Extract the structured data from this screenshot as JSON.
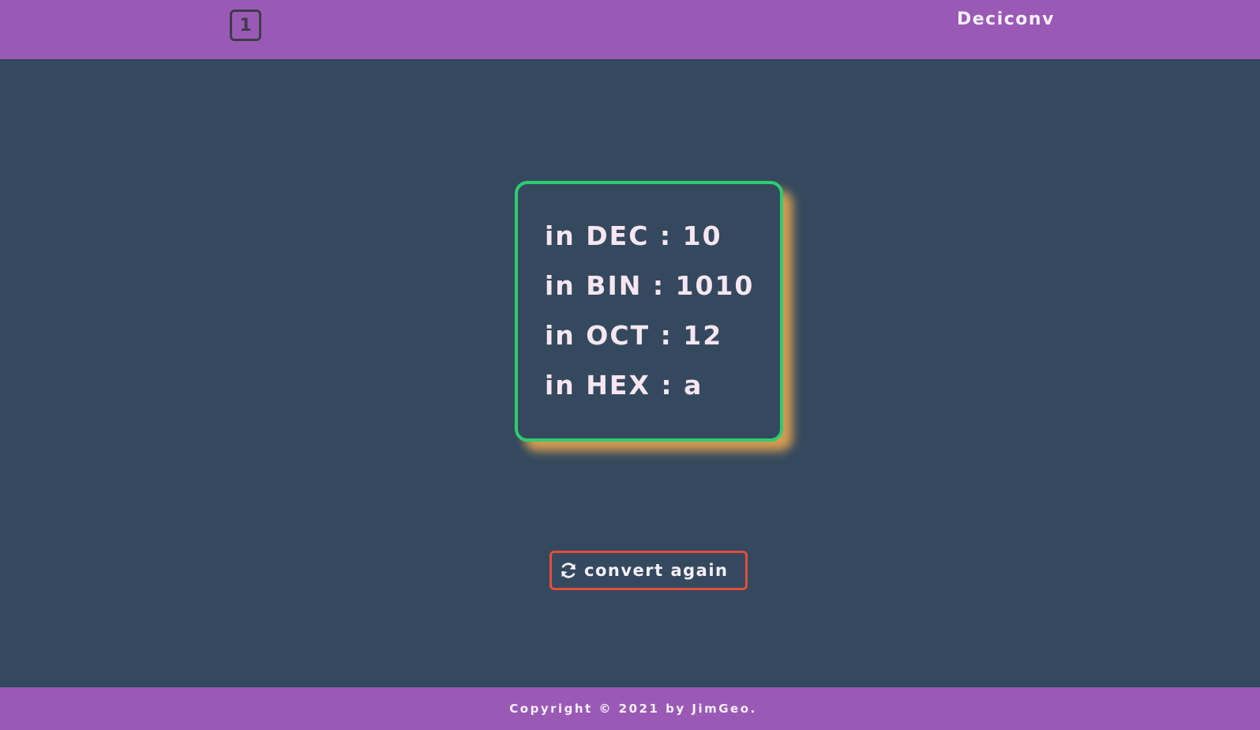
{
  "header": {
    "badge_label": "1",
    "brand": "Deciconv"
  },
  "results": {
    "dec": "in DEC : 10",
    "bin": "in BIN : 1010",
    "oct": "in OCT : 12",
    "hex": "in HEX : a"
  },
  "actions": {
    "convert_again_label": "convert again",
    "convert_again_icon": "refresh-icon"
  },
  "footer": {
    "copyright": "Copyright © 2021 by JimGeo."
  },
  "colors": {
    "header_bg": "#9b59b6",
    "page_bg": "#34495e",
    "card_border": "#2ecc71",
    "card_shadow": "#f0aa50",
    "button_border": "#e74c3c",
    "result_text": "#f7e6f1"
  }
}
